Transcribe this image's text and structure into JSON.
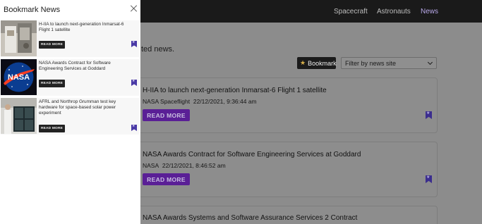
{
  "nav": {
    "items": [
      {
        "label": "Spacecraft"
      },
      {
        "label": "Astronauts"
      },
      {
        "label": "News"
      }
    ]
  },
  "main": {
    "subtitle_partial": "ted news.",
    "bookmark_label": "Bookmark",
    "filter_placeholder": "Filter by news site",
    "cards": [
      {
        "title": "H-IIA to launch next-generation Inmarsat-6 Flight 1 satellite",
        "source": "NASA Spaceflight",
        "date": "22/12/2021, 9:36:44 am",
        "button": "READ MORE"
      },
      {
        "title": "NASA Awards Contract for Software Engineering Services at Goddard",
        "source": "NASA",
        "date": "22/12/2021, 8:46:52 am",
        "button": "READ MORE"
      },
      {
        "title": "NASA Awards Systems and Software Assurance Services 2 Contract"
      }
    ]
  },
  "drawer": {
    "title": "Bookmark News",
    "items": [
      {
        "title": "H-IIA to launch next-generation Inmarsat-6 Flight 1 satellite",
        "button": "READ MORE"
      },
      {
        "title": "NASA Awards Contract for Software Engineering Services at Goddard",
        "button": "READ MORE"
      },
      {
        "title": "AFRL and Northrop Grumman test key hardware for space-based solar power experiment",
        "button": "READ MORE"
      }
    ]
  },
  "colors": {
    "accent_purple": "#6a2bc0",
    "bookmark_icon": "#4a3aa6",
    "star_gold": "#d8b04a"
  }
}
